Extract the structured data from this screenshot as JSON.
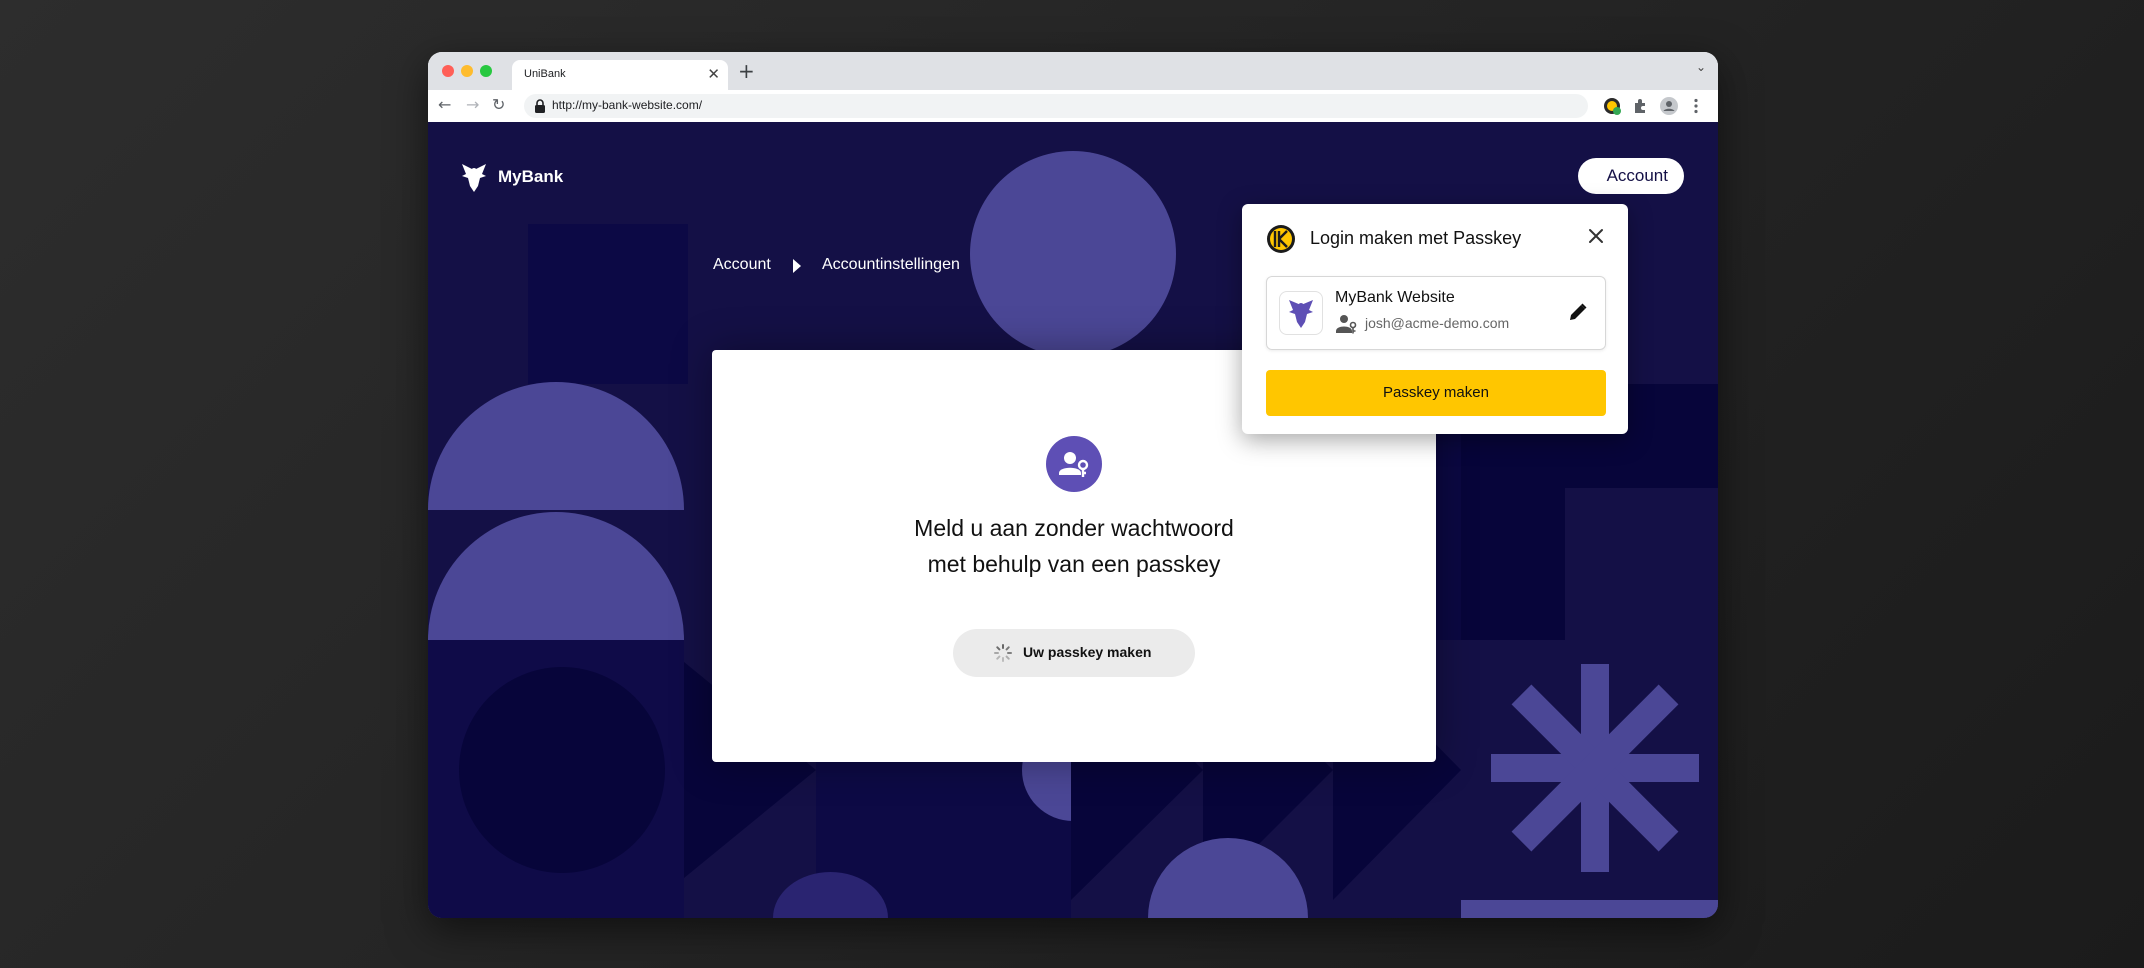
{
  "browser": {
    "tab_title": "UniBank",
    "tab_close": "✕",
    "new_tab": "+",
    "tabs_menu": "⌄",
    "url": "http://my-bank-website.com/",
    "back": "←",
    "forward": "→",
    "reload": "↻"
  },
  "site": {
    "brand": "MyBank",
    "account_button": "Account",
    "breadcrumb": [
      "Account",
      "Accountinstellingen"
    ]
  },
  "card": {
    "title_line1": "Meld u aan zonder wachtwoord",
    "title_line2": "met behulp van een passkey",
    "button_label": "Uw passkey maken"
  },
  "popup": {
    "title": "Login maken met Passkey",
    "entry_name": "MyBank Website",
    "entry_user": "josh@acme-demo.com",
    "button_label": "Passkey maken"
  },
  "colors": {
    "page_bg": "#141046",
    "shape_light": "#4b4796",
    "shape_dark": "#07053a",
    "accent_purple": "#5e4fb5",
    "button_yellow": "#ffc600"
  },
  "icons": {
    "brand_logo": "eagle-icon",
    "card_icon": "user-key-icon",
    "popup_logo": "keeper-logo-icon",
    "close": "close-icon",
    "edit": "pencil-icon",
    "spinner": "spinner-icon"
  }
}
